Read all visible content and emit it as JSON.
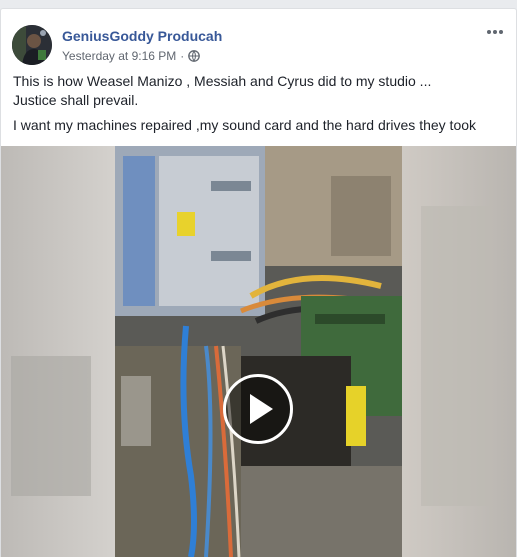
{
  "post": {
    "author": "GeniusGoddy Producah",
    "timestamp": "Yesterday at 9:16 PM",
    "separator": "·",
    "privacy_icon": "globe-icon",
    "more_icon": "more-options-icon",
    "text_paragraphs": [
      "This is how Weasel Manizo , Messiah and Cyrus did to my studio ...\nJustice shall prevail.",
      "I want my machines repaired ,my sound card and the hard drives they took"
    ]
  },
  "video": {
    "play_icon": "play-icon"
  },
  "colors": {
    "page_bg": "#e9ebee",
    "author": "#385898",
    "meta": "#616770",
    "text": "#1d2129"
  }
}
